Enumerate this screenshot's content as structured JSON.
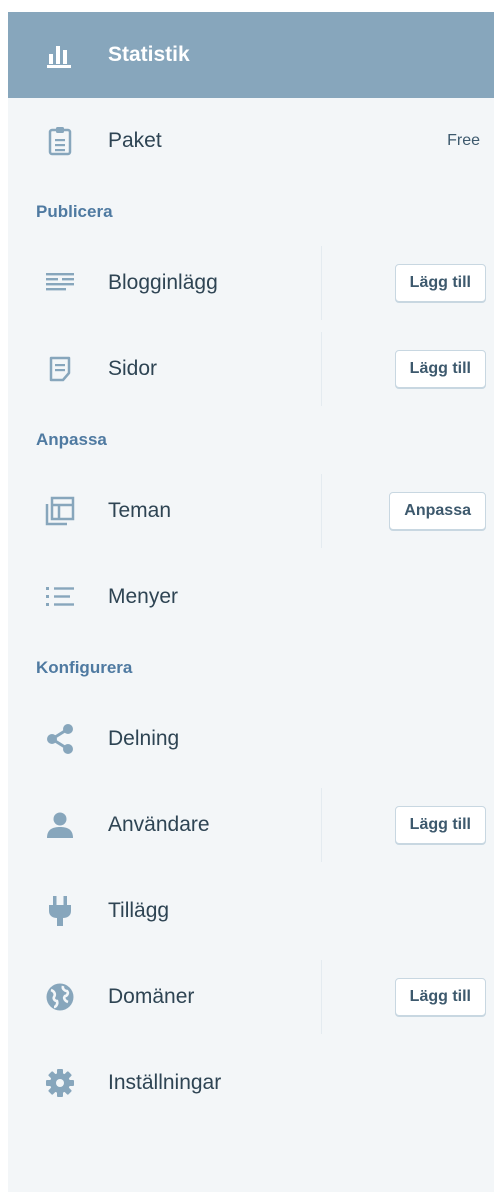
{
  "nav": {
    "stats": {
      "label": "Statistik",
      "icon": "bar-chart-icon"
    },
    "plans": {
      "label": "Paket",
      "badge": "Free",
      "icon": "clipboard-icon"
    }
  },
  "sections": {
    "publish": {
      "title": "Publicera",
      "posts": {
        "label": "Blogginlägg",
        "button": "Lägg till",
        "icon": "posts-icon"
      },
      "pages": {
        "label": "Sidor",
        "button": "Lägg till",
        "icon": "page-icon"
      }
    },
    "personalize": {
      "title": "Anpassa",
      "themes": {
        "label": "Teman",
        "button": "Anpassa",
        "icon": "themes-icon"
      },
      "menus": {
        "label": "Menyer",
        "icon": "menus-icon"
      }
    },
    "configure": {
      "title": "Konfigurera",
      "sharing": {
        "label": "Delning",
        "icon": "share-icon"
      },
      "people": {
        "label": "Användare",
        "button": "Lägg till",
        "icon": "user-icon"
      },
      "plugins": {
        "label": "Tillägg",
        "icon": "plug-icon"
      },
      "domains": {
        "label": "Domäner",
        "button": "Lägg till",
        "icon": "globe-icon"
      },
      "settings": {
        "label": "Inställningar",
        "icon": "gear-icon"
      }
    }
  },
  "colors": {
    "active_bg": "#87a6bc",
    "sidebar_bg": "#f3f6f8",
    "icon": "#87a6bc",
    "text": "#2e4453",
    "section_title": "#4f7aa1"
  }
}
